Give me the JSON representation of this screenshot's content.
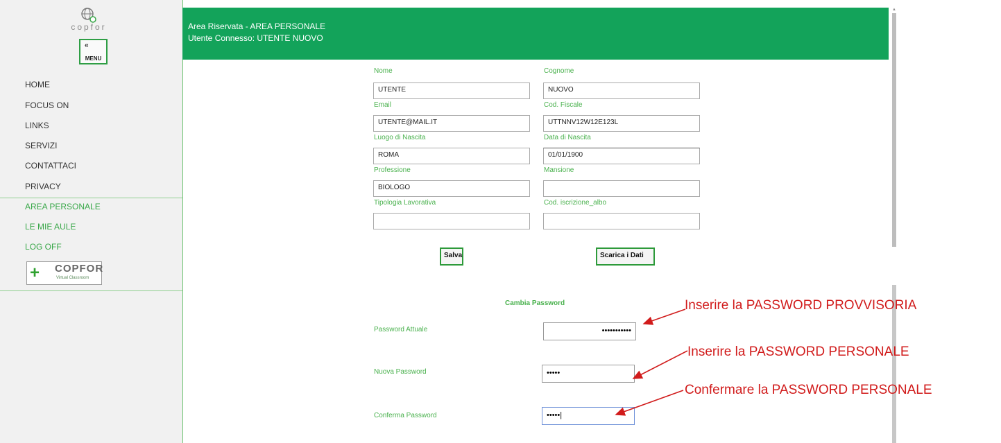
{
  "sidebar": {
    "logo_text": "copfor",
    "menu_chevron": "«",
    "menu_label": "MENU",
    "items": [
      {
        "label": "HOME"
      },
      {
        "label": "FOCUS ON"
      },
      {
        "label": "LINKS"
      },
      {
        "label": "SERVIZI"
      },
      {
        "label": "CONTATTACI"
      },
      {
        "label": "PRIVACY"
      }
    ],
    "user_items": [
      {
        "label": "AREA PERSONALE"
      },
      {
        "label": "LE MIE AULE"
      },
      {
        "label": "LOG OFF"
      }
    ],
    "badge": {
      "title": "COPFOR",
      "subtitle": "Virtual Classroom"
    }
  },
  "header": {
    "line1": "Area Riservata - AREA PERSONALE",
    "line2": "Utente Connesso: UTENTE NUOVO"
  },
  "form": {
    "nome_label": "Nome",
    "nome_value": "UTENTE",
    "cognome_label": "Cognome",
    "cognome_value": "NUOVO",
    "email_label": "Email",
    "email_value": "UTENTE@MAIL.IT",
    "codfiscale_label": "Cod. Fiscale",
    "codfiscale_value": "UTTNNV12W12E123L",
    "luogo_label": "Luogo di Nascita",
    "luogo_value": "ROMA",
    "data_label": "Data di Nascita",
    "data_value": "01/01/1900",
    "professione_label": "Professione",
    "professione_value": "BIOLOGO",
    "mansione_label": "Mansione",
    "mansione_value": "",
    "tipologia_label": "Tipologia Lavorativa",
    "tipologia_value": "",
    "albo_label": "Cod. iscrizione_albo",
    "albo_value": "",
    "save_label": "Salva",
    "download_label": "Scarica i Dati"
  },
  "password": {
    "title": "Cambia Password",
    "current_label": "Password Attuale",
    "current_value": "•••••••••••",
    "new_label": "Nuova Password",
    "new_value": "•••••",
    "confirm_label": "Conferma Password",
    "confirm_value": "•••••|"
  },
  "annotations": {
    "a1": "Inserire la PASSWORD PROVVISORIA",
    "a2": "Inserire la PASSWORD   PERSONALE",
    "a3": "Confermare la PASSWORD PERSONALE",
    "color": "#d11b1b"
  },
  "colors": {
    "header_bg": "#13a35a",
    "accent_green": "#49b14d"
  }
}
